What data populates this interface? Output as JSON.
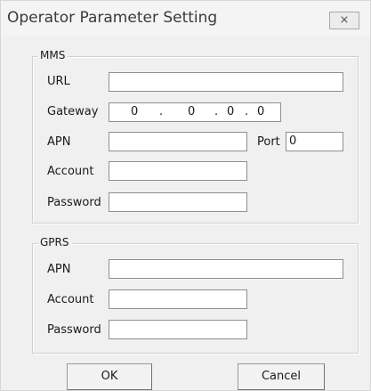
{
  "window": {
    "title": "Operator Parameter Setting",
    "close_glyph": "⨯"
  },
  "mms": {
    "legend": "MMS",
    "url_label": "URL",
    "url_value": "",
    "gateway_label": "Gateway",
    "gateway_octets": [
      "0",
      "0",
      "0",
      "0"
    ],
    "gateway_dot": ".",
    "apn_label": "APN",
    "apn_value": "",
    "port_label": "Port",
    "port_value": "0",
    "account_label": "Account",
    "account_value": "",
    "password_label": "Password",
    "password_value": ""
  },
  "gprs": {
    "legend": "GPRS",
    "apn_label": "APN",
    "apn_value": "",
    "account_label": "Account",
    "account_value": "",
    "password_label": "Password",
    "password_value": ""
  },
  "buttons": {
    "ok_label": "OK",
    "cancel_label": "Cancel"
  }
}
